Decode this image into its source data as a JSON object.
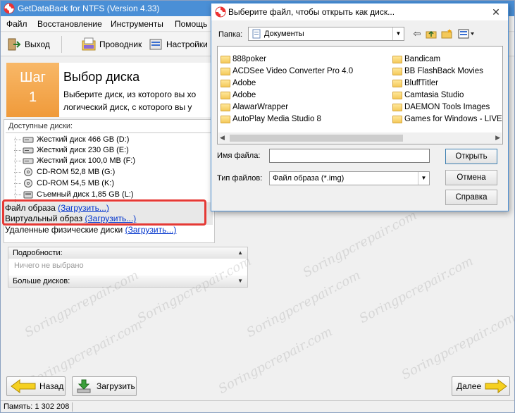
{
  "main_window": {
    "title": "GetDataBack for NTFS (Version 4.33)",
    "menu": [
      "Файл",
      "Восстановление",
      "Инструменты",
      "Помощь"
    ],
    "toolbar": {
      "exit_label": "Выход",
      "explorer_label": "Проводник",
      "settings_label": "Настройки"
    },
    "step": {
      "label_line1": "Шаг",
      "label_line2": "1",
      "title": "Выбор диска",
      "desc_line1": "Выберите диск, из которого вы хо",
      "desc_line2": "логический диск, с которого вы у"
    },
    "disks": {
      "label": "Доступные диски:",
      "items": [
        {
          "label": "Жесткий диск 466 GB (D:)",
          "icon": "hard-drive-icon"
        },
        {
          "label": "Жесткий диск 230 GB (E:)",
          "icon": "hard-drive-icon"
        },
        {
          "label": "Жесткий диск 100,0 MB (F:)",
          "icon": "hard-drive-icon"
        },
        {
          "label": "CD-ROM 52,8 MB (G:)",
          "icon": "cd-rom-icon"
        },
        {
          "label": "CD-ROM 54,5 MB (K:)",
          "icon": "cd-rom-icon"
        },
        {
          "label": "Съемный диск 1,85 GB (L:)",
          "icon": "removable-disk-icon"
        }
      ]
    },
    "image_file": {
      "label": "Файл образа ",
      "link": "(Загрузить...)"
    },
    "virtual_image": {
      "label": "Виртуальный образ ",
      "link": "(Загрузить...)"
    },
    "remote_disks": {
      "label": "Удаленные физические диски ",
      "link": "(Загрузить...)"
    },
    "details": {
      "header": "Подробности:",
      "empty_text": "Ничего не выбрано",
      "more_header": "Больше дисков:"
    },
    "buttons": {
      "back": "Назад",
      "load": "Загрузить",
      "next": "Далее"
    },
    "status": {
      "memory": "Память: 1 302 208"
    },
    "watermark": "Soringpcrepair.com",
    "highlight_color": "#e53935",
    "accent_color": "#f09a3a"
  },
  "dialog": {
    "title": "Выберите файл, чтобы открыть как диск...",
    "folder_label": "Папка:",
    "folder_value": "Документы",
    "files_left": [
      "888poker",
      "ACDSee Video Converter Pro 4.0",
      "Adobe",
      "Adobe",
      "AlawarWrapper",
      "AutoPlay Media Studio 8"
    ],
    "files_right": [
      "Bandicam",
      "BB FlashBack Movies",
      "BluffTitler",
      "Camtasia Studio",
      "DAEMON Tools Images",
      "Games for Windows - LIVE"
    ],
    "filename_label": "Имя файла:",
    "filename_value": "",
    "filetype_label": "Тип файлов:",
    "filetype_value": "Файл образа (*.img)",
    "buttons": {
      "open": "Открыть",
      "cancel": "Отмена",
      "help": "Справка"
    }
  }
}
